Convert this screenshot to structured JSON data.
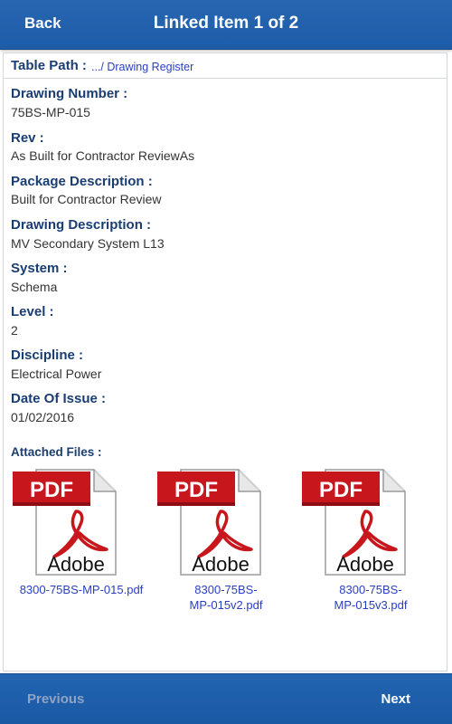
{
  "header": {
    "back_label": "Back",
    "title": "Linked Item 1 of 2"
  },
  "table_path": {
    "label": "Table Path :",
    "link": ".../ Drawing Register"
  },
  "fields": [
    {
      "label": "Drawing Number :",
      "value": "75BS-MP-015"
    },
    {
      "label": "Rev :",
      "value": "As Built for Contractor ReviewAs"
    },
    {
      "label": "Package Description :",
      "value": "Built for Contractor Review"
    },
    {
      "label": "Drawing Description :",
      "value": "MV Secondary System L13"
    },
    {
      "label": "System :",
      "value": "Schema"
    },
    {
      "label": "Level :",
      "value": "2"
    },
    {
      "label": "Discipline :",
      "value": "Electrical Power"
    },
    {
      "label": "Date Of Issue :",
      "value": "01/02/2016"
    }
  ],
  "attachments": {
    "label": "Attached Files :",
    "files": [
      {
        "name_line1": "8300-75BS-MP-015.pdf",
        "name_line2": "",
        "icon": "pdf-icon",
        "badge": "PDF",
        "brand": "Adobe"
      },
      {
        "name_line1": "8300-75BS-",
        "name_line2": "MP-015v2.pdf",
        "icon": "pdf-icon",
        "badge": "PDF",
        "brand": "Adobe"
      },
      {
        "name_line1": "8300-75BS-",
        "name_line2": "MP-015v3.pdf",
        "icon": "pdf-icon",
        "badge": "PDF",
        "brand": "Adobe"
      }
    ]
  },
  "footer": {
    "previous_label": "Previous",
    "next_label": "Next"
  },
  "colors": {
    "bar_blue": "#1d5ca8",
    "label_navy": "#1a3d72",
    "link_blue": "#2a3ec0",
    "pdf_red": "#c8161d",
    "disabled_text": "#8fa3c4"
  }
}
